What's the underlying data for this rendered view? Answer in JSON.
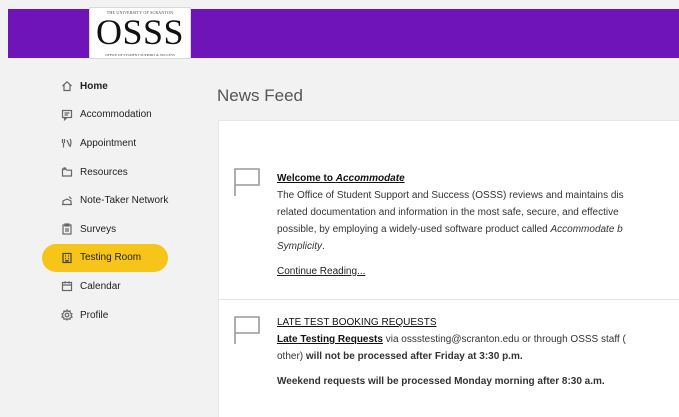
{
  "logo": {
    "top_text": "THE UNIVERSITY OF SCRANTON",
    "main_text": "OSSS",
    "bottom_text": "OFFICE OF STUDENT SUPPORT & SUCCESS"
  },
  "sidebar": {
    "items": [
      {
        "label": "Home",
        "icon": "home-icon"
      },
      {
        "label": "Accommodation",
        "icon": "chat-icon"
      },
      {
        "label": "Appointment",
        "icon": "appointment-icon"
      },
      {
        "label": "Resources",
        "icon": "folder-icon"
      },
      {
        "label": "Note-Taker Network",
        "icon": "note-icon"
      },
      {
        "label": "Surveys",
        "icon": "clipboard-icon"
      },
      {
        "label": "Testing Room",
        "icon": "building-icon"
      },
      {
        "label": "Calendar",
        "icon": "calendar-icon"
      },
      {
        "label": "Profile",
        "icon": "gear-icon"
      }
    ],
    "active_color": "#f7c51a"
  },
  "feed": {
    "title": "News Feed",
    "post1": {
      "title_prefix": "Welcome to ",
      "title_emph": "Accommodate",
      "line1": "The Office of Student Support and Success (OSSS) reviews and maintains dis",
      "line2": "related documentation and information in the most safe, secure, and effective",
      "line3_prefix": "possible, by employing a widely-used software product called ",
      "line3_emph": "Accommodate b",
      "line4": "Symplicity",
      "line4_suffix": ".",
      "continue_label": "Continue Reading..."
    },
    "post2": {
      "title": "LATE TEST BOOKING REQUESTS",
      "link_label": "Late Testing Requests",
      "line1_suffix": " via ossstesting@scranton.edu or through OSSS staff (",
      "line2_prefix": "other) ",
      "line2_bold": "will not be processed after Friday at 3:30 p.m.",
      "line3": "Weekend requests will be processed Monday morning after 8:30 a.m."
    }
  },
  "colors": {
    "topbar": "#6f14b8",
    "accent": "#f7c51a"
  }
}
